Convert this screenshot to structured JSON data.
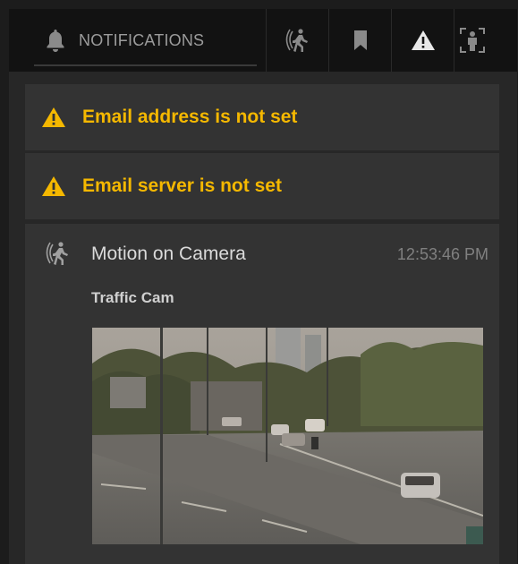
{
  "tabs": {
    "notifications_label": "NOTIFICATIONS",
    "items": [
      {
        "icon": "bell-icon"
      },
      {
        "icon": "motion-icon"
      },
      {
        "icon": "bookmark-icon"
      },
      {
        "icon": "warning-icon"
      },
      {
        "icon": "person-detection-icon"
      }
    ]
  },
  "warnings": [
    {
      "icon": "warning-icon",
      "text": "Email address is not set"
    },
    {
      "icon": "warning-icon",
      "text": "Email server is not set"
    }
  ],
  "event": {
    "icon": "motion-icon",
    "title": "Motion on Camera",
    "time": "12:53:46 PM",
    "source": "Traffic Cam"
  },
  "colors": {
    "warning": "#f5b800",
    "panel": "#333333",
    "background": "#272727",
    "tabbar": "#121212"
  }
}
